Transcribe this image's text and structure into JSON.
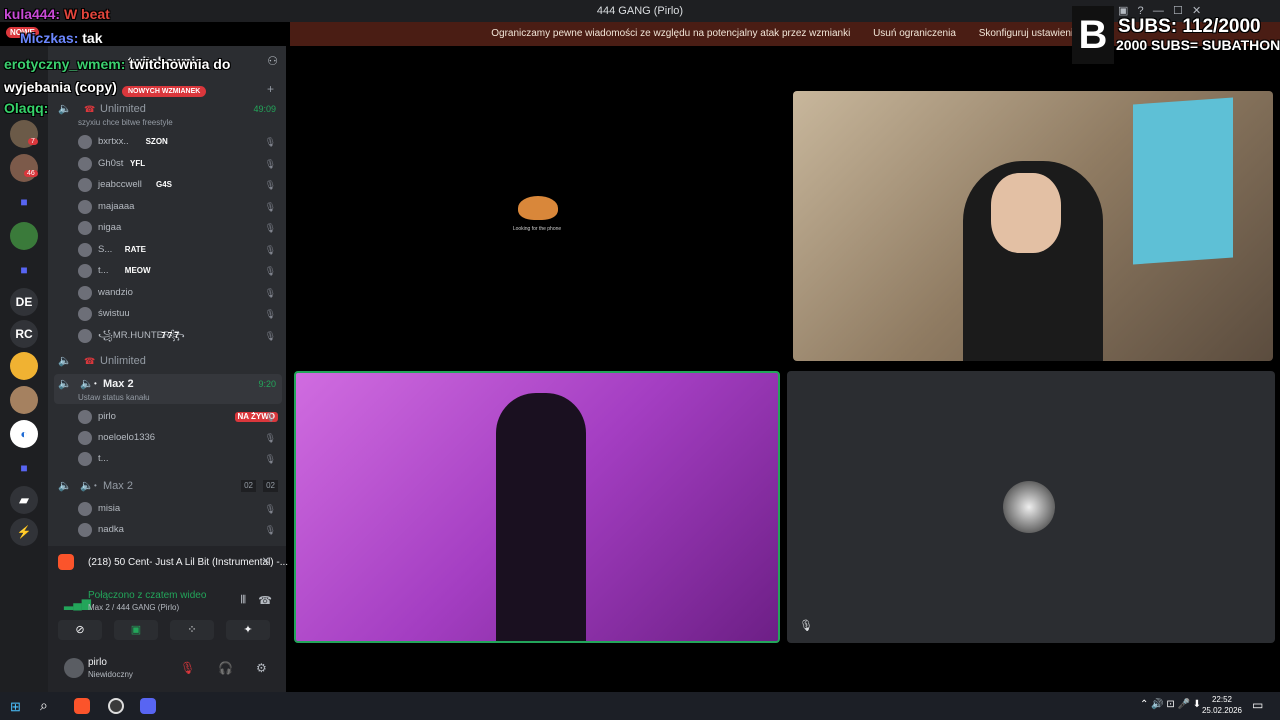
{
  "window": {
    "title": "444 GANG (Pirlo)"
  },
  "notice": {
    "text": "Ograniczamy pewne wiadomości ze względu na potencjalny atak przez wzmianki",
    "action1": "Usuń ograniczenia",
    "action2": "Skonfiguruj ustawienia"
  },
  "overlay": {
    "chat": [
      {
        "user": "kula444:",
        "msg": "W beat",
        "color": "#c84ad6"
      },
      {
        "user": "Miczkas:",
        "msg": "tak",
        "color": "#6c87ff"
      },
      {
        "user": "erotyczny_wmem:",
        "msg": "twitchownia do wyjebania (copy)",
        "color": "#3bd16f"
      },
      {
        "user": "Olaqq:",
        "msg": "",
        "color": "#36d36a"
      }
    ],
    "subs_line1": "SUBS: 112/2000",
    "subs_line2": "2000 SUBS= SUBATHON",
    "new_badge": "NOWE",
    "mentions_badge": "NOWYCH WZMIANEK"
  },
  "servers": [
    "DE",
    "RC"
  ],
  "server_badges": [
    "7",
    "46"
  ],
  "sidebar": {
    "server_name": "twitchownia",
    "channel1": {
      "name": "Unlimited",
      "topic": "szyxiu chce bitwe freestyle",
      "time": "49:09"
    },
    "members1": [
      {
        "name": "bxrtxx..",
        "tag": "SZON"
      },
      {
        "name": "Gh0st",
        "tag": "YFL"
      },
      {
        "name": "jeabccwell",
        "tag": "G4S"
      },
      {
        "name": "majaaaa",
        "tag": ""
      },
      {
        "name": "nigaa",
        "tag": ""
      },
      {
        "name": "S...",
        "tag": "RATE"
      },
      {
        "name": "t...",
        "tag": "MEOW"
      },
      {
        "name": "wandzio",
        "tag": ""
      },
      {
        "name": "świstuu",
        "tag": ""
      },
      {
        "name": "꧁MR.HUNTER꧂",
        "tag": "7 7 7"
      }
    ],
    "channel2": "Unlimited",
    "channel3": {
      "name": "Max 2",
      "status": "Ustaw status kanału",
      "time": "9:20"
    },
    "members3": [
      {
        "name": "pirlo",
        "live": "NA ŻYWO"
      },
      {
        "name": "noeloelo1336",
        "live": ""
      },
      {
        "name": "t...",
        "live": ""
      }
    ],
    "channel4": {
      "name": "Max 2",
      "count_a": "02",
      "count_b": "02"
    },
    "members4": [
      {
        "name": "misia"
      },
      {
        "name": "nadka"
      }
    ]
  },
  "media": {
    "title": "(218) 50 Cent- Just A Lil Bit (Instrumental) -..."
  },
  "voice": {
    "status": "Połączono z czatem wideo",
    "location": "Max 2 / 444 GANG (Pirlo)"
  },
  "user": {
    "name": "pirlo",
    "status": "Niewidoczny"
  },
  "tiles": {
    "looking_text": "Looking for the phone"
  },
  "taskbar": {
    "time": "22:52",
    "date": "25.02.2026"
  }
}
